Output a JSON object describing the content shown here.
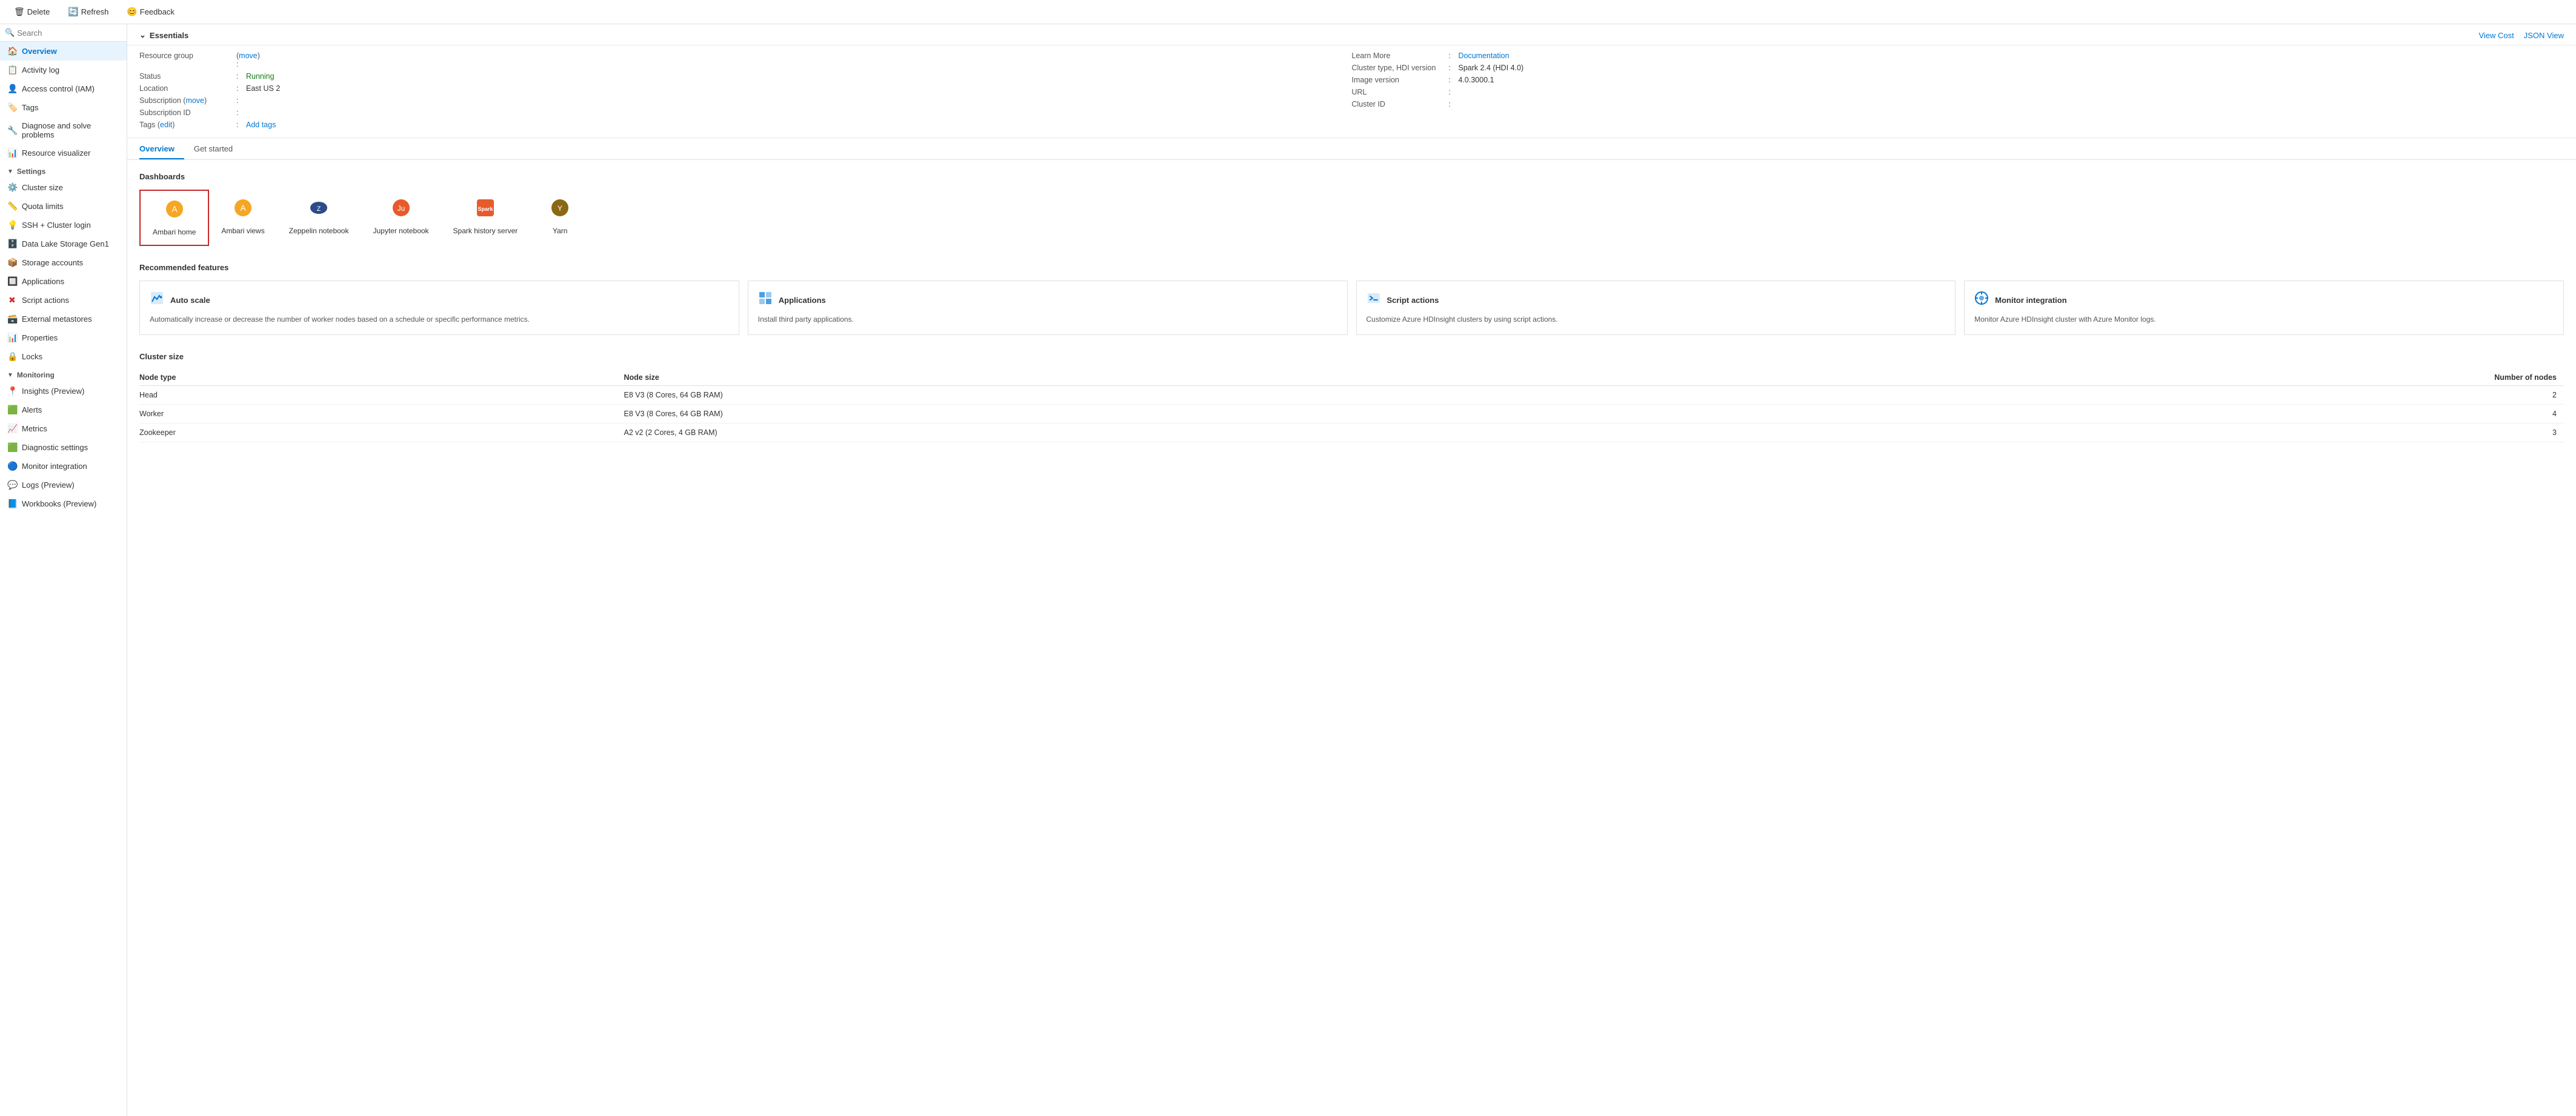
{
  "toolbar": {
    "delete_label": "Delete",
    "refresh_label": "Refresh",
    "feedback_label": "Feedback"
  },
  "sidebar": {
    "search_placeholder": "Search",
    "items": [
      {
        "id": "overview",
        "label": "Overview",
        "icon": "🏠",
        "active": true
      },
      {
        "id": "activity-log",
        "label": "Activity log",
        "icon": "📋"
      },
      {
        "id": "access-control",
        "label": "Access control (IAM)",
        "icon": "👤"
      },
      {
        "id": "tags",
        "label": "Tags",
        "icon": "🏷️"
      },
      {
        "id": "diagnose",
        "label": "Diagnose and solve problems",
        "icon": "🔧"
      },
      {
        "id": "resource-visualizer",
        "label": "Resource visualizer",
        "icon": "📊"
      }
    ],
    "settings": {
      "label": "Settings",
      "items": [
        {
          "id": "cluster-size",
          "label": "Cluster size",
          "icon": "⚙️"
        },
        {
          "id": "quota-limits",
          "label": "Quota limits",
          "icon": "📏"
        },
        {
          "id": "ssh-cluster-login",
          "label": "SSH + Cluster login",
          "icon": "💡"
        },
        {
          "id": "data-lake-storage",
          "label": "Data Lake Storage Gen1",
          "icon": "🗄️"
        },
        {
          "id": "storage-accounts",
          "label": "Storage accounts",
          "icon": "📦"
        },
        {
          "id": "applications",
          "label": "Applications",
          "icon": "🔲"
        },
        {
          "id": "script-actions",
          "label": "Script actions",
          "icon": "✖"
        },
        {
          "id": "external-metastores",
          "label": "External metastores",
          "icon": "🗃️"
        },
        {
          "id": "properties",
          "label": "Properties",
          "icon": "📊"
        },
        {
          "id": "locks",
          "label": "Locks",
          "icon": "🔒"
        }
      ]
    },
    "monitoring": {
      "label": "Monitoring",
      "items": [
        {
          "id": "insights",
          "label": "Insights (Preview)",
          "icon": "📍"
        },
        {
          "id": "alerts",
          "label": "Alerts",
          "icon": "🟩"
        },
        {
          "id": "metrics",
          "label": "Metrics",
          "icon": "📈"
        },
        {
          "id": "diagnostic-settings",
          "label": "Diagnostic settings",
          "icon": "🟩"
        },
        {
          "id": "monitor-integration",
          "label": "Monitor integration",
          "icon": "🔵"
        },
        {
          "id": "logs-preview",
          "label": "Logs (Preview)",
          "icon": "💬"
        },
        {
          "id": "workbooks-preview",
          "label": "Workbooks (Preview)",
          "icon": "📘"
        }
      ]
    }
  },
  "essentials": {
    "section_title": "Essentials",
    "resource_group_label": "Resource group",
    "resource_group_move": "move",
    "status_label": "Status",
    "status_value": "Running",
    "location_label": "Location",
    "location_value": "East US 2",
    "subscription_label": "Subscription",
    "subscription_move": "move",
    "subscription_id_label": "Subscription ID",
    "tags_label": "Tags",
    "tags_edit": "edit",
    "tags_add": "Add tags",
    "learn_more_label": "Learn More",
    "documentation_link": "Documentation",
    "cluster_type_label": "Cluster type, HDI version",
    "cluster_type_value": "Spark 2.4 (HDI 4.0)",
    "image_version_label": "Image version",
    "image_version_value": "4.0.3000.1",
    "url_label": "URL",
    "cluster_id_label": "Cluster ID",
    "view_cost_label": "View Cost",
    "json_view_label": "JSON View"
  },
  "tabs": [
    {
      "id": "overview",
      "label": "Overview",
      "active": true
    },
    {
      "id": "get-started",
      "label": "Get started",
      "active": false
    }
  ],
  "dashboards": {
    "title": "Dashboards",
    "items": [
      {
        "id": "ambari-home",
        "label": "Ambari home",
        "icon": "🟡",
        "highlighted": true
      },
      {
        "id": "ambari-views",
        "label": "Ambari views",
        "icon": "🟡"
      },
      {
        "id": "zeppelin-notebook",
        "label": "Zeppelin notebook",
        "icon": "🔵"
      },
      {
        "id": "jupyter-notebook",
        "label": "Jupyter notebook",
        "icon": "🔄"
      },
      {
        "id": "spark-history-server",
        "label": "Spark history server",
        "icon": "⚡"
      },
      {
        "id": "yarn",
        "label": "Yarn",
        "icon": "🐝"
      }
    ]
  },
  "recommended_features": {
    "title": "Recommended features",
    "items": [
      {
        "id": "auto-scale",
        "icon": "📋",
        "title": "Auto scale",
        "description": "Automatically increase or decrease the number of worker nodes based on a schedule or specific performance metrics."
      },
      {
        "id": "applications",
        "icon": "📱",
        "title": "Applications",
        "description": "Install third party applications."
      },
      {
        "id": "script-actions",
        "icon": "💻",
        "title": "Script actions",
        "description": "Customize Azure HDInsight clusters by using script actions."
      },
      {
        "id": "monitor-integration",
        "icon": "⏱",
        "title": "Monitor integration",
        "description": "Monitor Azure HDInsight cluster with Azure Monitor logs."
      }
    ]
  },
  "cluster_size": {
    "title": "Cluster size",
    "columns": [
      "Node type",
      "Node size",
      "Number of nodes"
    ],
    "rows": [
      {
        "node_type": "Head",
        "node_size": "E8 V3 (8 Cores, 64 GB RAM)",
        "node_count": "2"
      },
      {
        "node_type": "Worker",
        "node_size": "E8 V3 (8 Cores, 64 GB RAM)",
        "node_count": "4"
      },
      {
        "node_type": "Zookeeper",
        "node_size": "A2 v2 (2 Cores, 4 GB RAM)",
        "node_count": "3"
      }
    ]
  }
}
